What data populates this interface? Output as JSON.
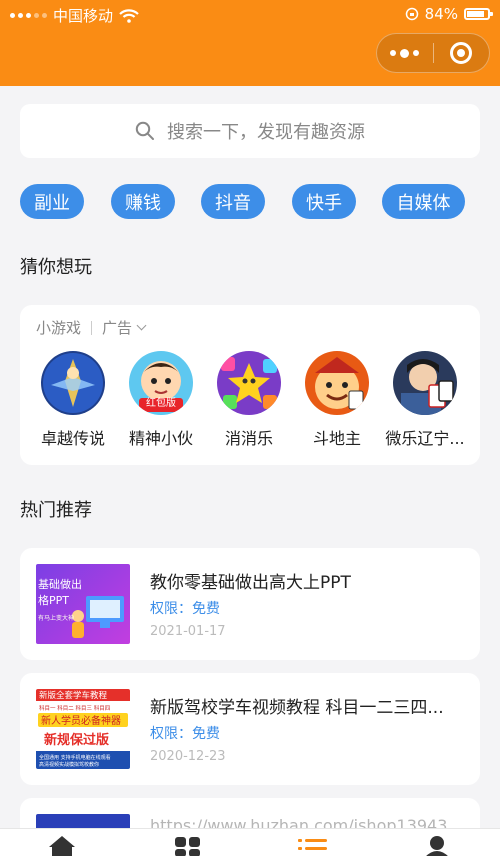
{
  "status_bar": {
    "carrier": "中国移动",
    "battery": "84%"
  },
  "search": {
    "placeholder": "搜索一下，发现有趣资源"
  },
  "tags": [
    "副业",
    "赚钱",
    "抖音",
    "快手",
    "自媒体"
  ],
  "guess": {
    "title": "猜你想玩",
    "source": "小游戏",
    "ad_label": "广告",
    "games": [
      {
        "name": "卓越传说",
        "icon": "warrior-icon"
      },
      {
        "name": "精神小伙",
        "icon": "cartoon-boy-icon",
        "badge": "红包版"
      },
      {
        "name": "消消乐",
        "icon": "star-puzzle-icon"
      },
      {
        "name": "斗地主",
        "icon": "landlord-icon"
      },
      {
        "name": "微乐辽宁...",
        "icon": "card-game-icon"
      }
    ]
  },
  "hot": {
    "title": "热门推荐",
    "items": [
      {
        "title": "教你零基础做出高大上PPT",
        "permission": "权限：免费",
        "date": "2021-01-17",
        "thumb_text": [
          "基础做出",
          "格PPT",
          "有马上变大神"
        ]
      },
      {
        "title": "新版驾校学车视频教程 科目一二三四...",
        "permission": "权限：免费",
        "date": "2020-12-23",
        "thumb_text": [
          "新版全套学车教程",
          "科目一 科目二 科目三 科目四",
          "新人学员必备神器",
          "新规保过版",
          "全国通用 支持手机电脑在线观看",
          "高清视频实战模拟驾校教你"
        ]
      }
    ]
  },
  "watermark": "https://www.huzhan.com/ishop13943",
  "tabbar": {
    "items": [
      {
        "icon": "home-icon"
      },
      {
        "icon": "grid-icon"
      },
      {
        "icon": "list-icon"
      },
      {
        "icon": "user-icon"
      }
    ]
  }
}
